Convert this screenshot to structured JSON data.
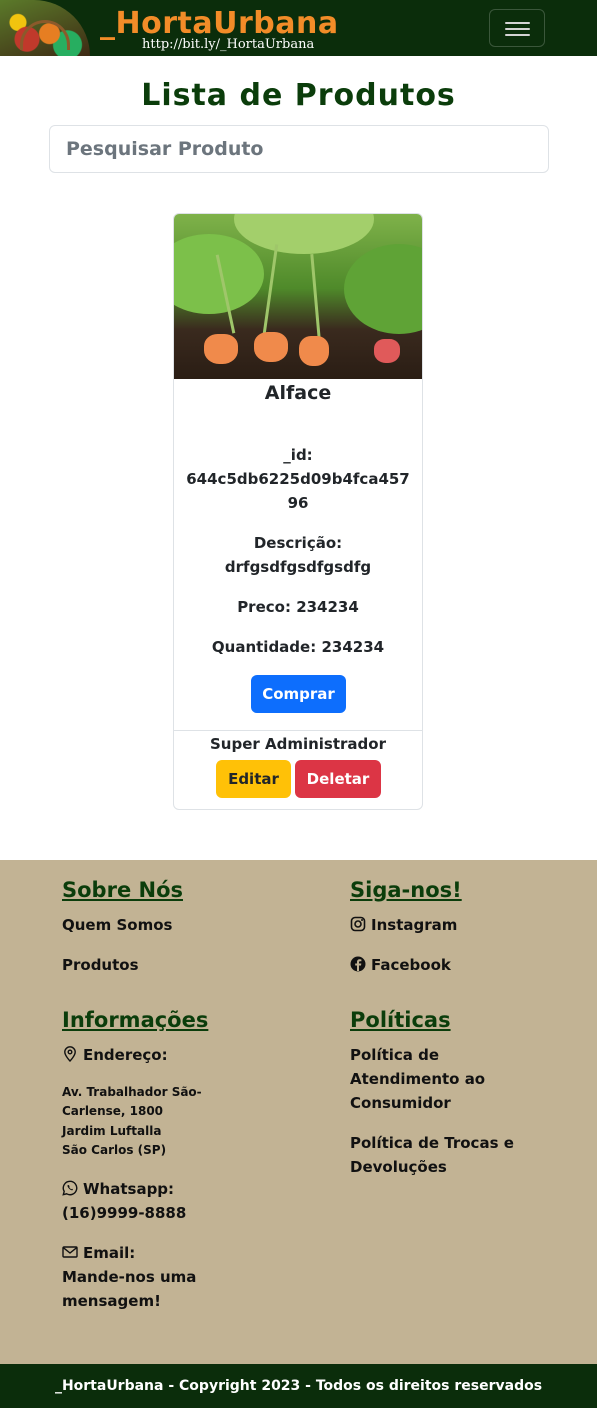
{
  "navbar": {
    "brand": "_HortaUrbana",
    "url": "http://bit.ly/_HortaUrbana"
  },
  "main": {
    "title": "Lista de Produtos",
    "search_placeholder": "Pesquisar Produto"
  },
  "product": {
    "name": "Alface",
    "id_label": "_id:",
    "id": "644c5db6225d09b4fca45796",
    "desc_label": "Descrição:",
    "desc": "drfgsdfgsdfgsdfg",
    "price_label": "Preco:",
    "price": "234234",
    "qty_label": "Quantidade:",
    "qty": "234234",
    "buy_label": "Comprar",
    "admin_label": "Super Administrador",
    "edit_label": "Editar",
    "delete_label": "Deletar"
  },
  "footer": {
    "about_title": "Sobre Nós",
    "about_links": [
      "Quem Somos",
      "Produtos"
    ],
    "follow_title": "Siga-nos!",
    "instagram": "Instagram",
    "facebook": "Facebook",
    "info_title": "Informações",
    "address_label": "Endereço:",
    "address_lines": [
      "Av. Trabalhador São-",
      "Carlense, 1800",
      "Jardim Luftalla",
      "São Carlos (SP)"
    ],
    "whatsapp_label": "Whatsapp:",
    "whatsapp": "(16)9999-8888",
    "email_label": "Email:",
    "email_text_1": "Mande-nos uma",
    "email_text_2": "mensagem!",
    "policies_title": "Políticas",
    "policy_1_lines": [
      "Política de",
      "Atendimento ao",
      "Consumidor"
    ],
    "policy_2_lines": [
      "Política de Trocas e",
      "Devoluções"
    ],
    "copyright": "_HortaUrbana - Copyright 2023 - Todos os direitos reservados"
  },
  "colors": {
    "brand_orange": "#f28c28",
    "dark_green": "#0b2d0b",
    "footer_bg": "#c2b394",
    "primary": "#0d6efd",
    "warning": "#ffc107",
    "danger": "#dc3545"
  }
}
